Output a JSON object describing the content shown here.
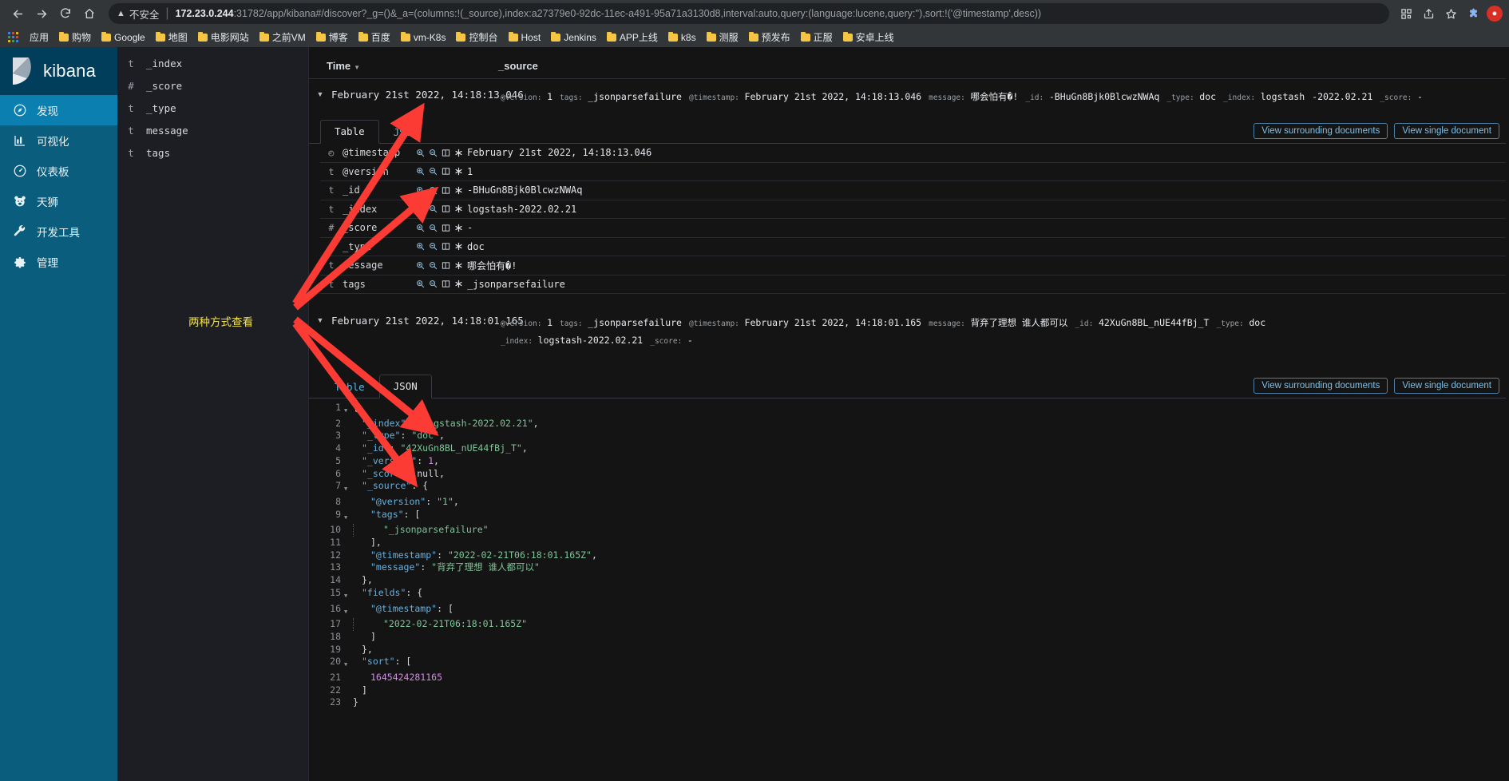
{
  "browser": {
    "nav": {
      "back_icon": "arrow-left-icon",
      "forward_icon": "arrow-right-icon",
      "reload_icon": "reload-icon",
      "home_icon": "home-icon"
    },
    "omnibox": {
      "security_icon": "warning-triangle-icon",
      "security_label": "不安全",
      "url_host": "172.23.0.244",
      "url_rest": ":31782/app/kibana#/discover?_g=()&_a=(columns:!(_source),index:a27379e0-92dc-11ec-a491-95a71a3130d8,interval:auto,query:(language:lucene,query:''),sort:!('@timestamp',desc))",
      "right_icons": [
        "qr-code-icon",
        "share-icon",
        "star-icon",
        "extensions-icon",
        "profile-avatar"
      ]
    },
    "bookmarks": {
      "apps_icon": "apps-grid-icon",
      "items": [
        {
          "label": "应用",
          "icon": "apps-grid-icon"
        },
        {
          "label": "购物",
          "icon": "folder-icon"
        },
        {
          "label": "Google",
          "icon": "folder-icon"
        },
        {
          "label": "地图",
          "icon": "folder-icon"
        },
        {
          "label": "电影网站",
          "icon": "folder-icon"
        },
        {
          "label": "之前VM",
          "icon": "folder-icon"
        },
        {
          "label": "博客",
          "icon": "folder-icon"
        },
        {
          "label": "百度",
          "icon": "folder-icon"
        },
        {
          "label": "vm-K8s",
          "icon": "folder-icon"
        },
        {
          "label": "控制台",
          "icon": "folder-icon"
        },
        {
          "label": "Host",
          "icon": "folder-icon"
        },
        {
          "label": "Jenkins",
          "icon": "folder-icon"
        },
        {
          "label": "APP上线",
          "icon": "folder-icon"
        },
        {
          "label": "k8s",
          "icon": "folder-icon"
        },
        {
          "label": "测服",
          "icon": "folder-icon"
        },
        {
          "label": "预发布",
          "icon": "folder-icon"
        },
        {
          "label": "正服",
          "icon": "folder-icon"
        },
        {
          "label": "安卓上线",
          "icon": "folder-icon"
        }
      ]
    }
  },
  "kibana": {
    "brand": "kibana",
    "nav": [
      {
        "label": "发现",
        "icon": "compass-icon",
        "active": true
      },
      {
        "label": "可视化",
        "icon": "bar-chart-icon",
        "active": false
      },
      {
        "label": "仪表板",
        "icon": "dashboard-icon",
        "active": false
      },
      {
        "label": "天狮",
        "icon": "bear-icon",
        "active": false
      },
      {
        "label": "开发工具",
        "icon": "wrench-icon",
        "active": false
      },
      {
        "label": "管理",
        "icon": "gear-icon",
        "active": false
      }
    ],
    "fields": [
      {
        "type": "t",
        "name": "_index"
      },
      {
        "type": "#",
        "name": "_score"
      },
      {
        "type": "t",
        "name": "_type"
      },
      {
        "type": "t",
        "name": "message"
      },
      {
        "type": "t",
        "name": "tags"
      }
    ],
    "table_header": {
      "time": "Time",
      "source": "_source",
      "sort_icon": "caret-down-icon"
    },
    "doc1": {
      "time": "February 21st 2022, 14:18:13.046",
      "source_pairs": [
        {
          "key": "@version:",
          "value": "1"
        },
        {
          "key": "tags:",
          "value": "_jsonparsefailure"
        },
        {
          "key": "@timestamp:",
          "value": "February 21st 2022, 14:18:13.046"
        },
        {
          "key": "message:",
          "value": "哪会怕有�!"
        },
        {
          "key": "_id:",
          "value": "-BHuGn8Bjk0BlcwzNWAq"
        },
        {
          "key": "_type:",
          "value": "doc"
        },
        {
          "key": "_index:",
          "value": "logstash"
        },
        {
          "key": "",
          "value": "-2022.02.21"
        },
        {
          "key": "_score:",
          "value": "-"
        }
      ],
      "tabs": [
        {
          "label": "Table",
          "active": true
        },
        {
          "label": "JSON",
          "active": false
        }
      ],
      "actions": [
        {
          "label": "View surrounding documents"
        },
        {
          "label": "View single document"
        }
      ],
      "detail_rows": [
        {
          "type": "◴",
          "name": "@timestamp",
          "value": "February 21st 2022, 14:18:13.046"
        },
        {
          "type": "t",
          "name": "@version",
          "value": "1"
        },
        {
          "type": "t",
          "name": "_id",
          "value": "-BHuGn8Bjk0BlcwzNWAq"
        },
        {
          "type": "t",
          "name": "_index",
          "value": "logstash-2022.02.21"
        },
        {
          "type": "#",
          "name": "_score",
          "value": "-"
        },
        {
          "type": "t",
          "name": "_type",
          "value": "doc"
        },
        {
          "type": "t",
          "name": "message",
          "value": "哪会怕有�!"
        },
        {
          "type": "t",
          "name": "tags",
          "value": "_jsonparsefailure"
        }
      ],
      "row_icons": [
        "zoom-in-icon",
        "zoom-out-icon",
        "toggle-column-icon",
        "filter-exists-icon"
      ]
    },
    "doc2": {
      "time": "February 21st 2022, 14:18:01.165",
      "source_pairs": [
        {
          "key": "@version:",
          "value": "1"
        },
        {
          "key": "tags:",
          "value": "_jsonparsefailure"
        },
        {
          "key": "@timestamp:",
          "value": "February 21st 2022, 14:18:01.165"
        },
        {
          "key": "message:",
          "value": "背弃了理想 谁人都可以"
        },
        {
          "key": "_id:",
          "value": "42XuGn8BL_nUE44fBj_T"
        },
        {
          "key": "_type:",
          "value": "doc"
        }
      ],
      "source_pairs_line2": [
        {
          "key": "_index:",
          "value": "logstash-2022.02.21"
        },
        {
          "key": "_score:",
          "value": "-"
        }
      ],
      "tabs": [
        {
          "label": "Table",
          "active": false
        },
        {
          "label": "JSON",
          "active": true
        }
      ],
      "actions": [
        {
          "label": "View surrounding documents"
        },
        {
          "label": "View single document"
        }
      ],
      "json_lines": [
        {
          "n": 1,
          "fold": true,
          "indent": 0,
          "tokens": [
            {
              "t": "p",
              "v": "{"
            }
          ]
        },
        {
          "n": 2,
          "fold": false,
          "indent": 1,
          "tokens": [
            {
              "t": "k",
              "v": "\"_index\""
            },
            {
              "t": "p",
              "v": ": "
            },
            {
              "t": "s",
              "v": "\"logstash-2022.02.21\""
            },
            {
              "t": "p",
              "v": ","
            }
          ]
        },
        {
          "n": 3,
          "fold": false,
          "indent": 1,
          "tokens": [
            {
              "t": "k",
              "v": "\"_type\""
            },
            {
              "t": "p",
              "v": ": "
            },
            {
              "t": "s",
              "v": "\"doc\""
            },
            {
              "t": "p",
              "v": ","
            }
          ]
        },
        {
          "n": 4,
          "fold": false,
          "indent": 1,
          "tokens": [
            {
              "t": "k",
              "v": "\"_id\""
            },
            {
              "t": "p",
              "v": ": "
            },
            {
              "t": "s",
              "v": "\"42XuGn8BL_nUE44fBj_T\""
            },
            {
              "t": "p",
              "v": ","
            }
          ]
        },
        {
          "n": 5,
          "fold": false,
          "indent": 1,
          "tokens": [
            {
              "t": "k",
              "v": "\"_version\""
            },
            {
              "t": "p",
              "v": ": "
            },
            {
              "t": "n",
              "v": "1"
            },
            {
              "t": "p",
              "v": ","
            }
          ]
        },
        {
          "n": 6,
          "fold": false,
          "indent": 1,
          "tokens": [
            {
              "t": "k",
              "v": "\"_score\""
            },
            {
              "t": "p",
              "v": ": "
            },
            {
              "t": "p",
              "v": "null"
            },
            {
              "t": "p",
              "v": ","
            }
          ]
        },
        {
          "n": 7,
          "fold": true,
          "indent": 1,
          "tokens": [
            {
              "t": "k",
              "v": "\"_source\""
            },
            {
              "t": "p",
              "v": ": {"
            }
          ]
        },
        {
          "n": 8,
          "fold": false,
          "indent": 2,
          "tokens": [
            {
              "t": "k",
              "v": "\"@version\""
            },
            {
              "t": "p",
              "v": ": "
            },
            {
              "t": "s",
              "v": "\"1\""
            },
            {
              "t": "p",
              "v": ","
            }
          ]
        },
        {
          "n": 9,
          "fold": true,
          "indent": 2,
          "tokens": [
            {
              "t": "k",
              "v": "\"tags\""
            },
            {
              "t": "p",
              "v": ": ["
            }
          ]
        },
        {
          "n": 10,
          "fold": false,
          "indent": 3,
          "guide": true,
          "tokens": [
            {
              "t": "s",
              "v": "\"_jsonparsefailure\""
            }
          ]
        },
        {
          "n": 11,
          "fold": false,
          "indent": 2,
          "tokens": [
            {
              "t": "p",
              "v": "],"
            }
          ]
        },
        {
          "n": 12,
          "fold": false,
          "indent": 2,
          "tokens": [
            {
              "t": "k",
              "v": "\"@timestamp\""
            },
            {
              "t": "p",
              "v": ": "
            },
            {
              "t": "s",
              "v": "\"2022-02-21T06:18:01.165Z\""
            },
            {
              "t": "p",
              "v": ","
            }
          ]
        },
        {
          "n": 13,
          "fold": false,
          "indent": 2,
          "tokens": [
            {
              "t": "k",
              "v": "\"message\""
            },
            {
              "t": "p",
              "v": ": "
            },
            {
              "t": "s",
              "v": "\"背弃了理想 谁人都可以\""
            }
          ]
        },
        {
          "n": 14,
          "fold": false,
          "indent": 1,
          "tokens": [
            {
              "t": "p",
              "v": "},"
            }
          ]
        },
        {
          "n": 15,
          "fold": true,
          "indent": 1,
          "tokens": [
            {
              "t": "k",
              "v": "\"fields\""
            },
            {
              "t": "p",
              "v": ": {"
            }
          ]
        },
        {
          "n": 16,
          "fold": true,
          "indent": 2,
          "tokens": [
            {
              "t": "k",
              "v": "\"@timestamp\""
            },
            {
              "t": "p",
              "v": ": ["
            }
          ]
        },
        {
          "n": 17,
          "fold": false,
          "indent": 3,
          "guide": true,
          "tokens": [
            {
              "t": "s",
              "v": "\"2022-02-21T06:18:01.165Z\""
            }
          ]
        },
        {
          "n": 18,
          "fold": false,
          "indent": 2,
          "tokens": [
            {
              "t": "p",
              "v": "]"
            }
          ]
        },
        {
          "n": 19,
          "fold": false,
          "indent": 1,
          "tokens": [
            {
              "t": "p",
              "v": "},"
            }
          ]
        },
        {
          "n": 20,
          "fold": true,
          "indent": 1,
          "tokens": [
            {
              "t": "k",
              "v": "\"sort\""
            },
            {
              "t": "p",
              "v": ": ["
            }
          ]
        },
        {
          "n": 21,
          "fold": false,
          "indent": 2,
          "tokens": [
            {
              "t": "n",
              "v": "1645424281165"
            }
          ]
        },
        {
          "n": 22,
          "fold": false,
          "indent": 1,
          "tokens": [
            {
              "t": "p",
              "v": "]"
            }
          ]
        },
        {
          "n": 23,
          "fold": false,
          "indent": 0,
          "tokens": [
            {
              "t": "p",
              "v": "}"
            }
          ]
        }
      ]
    }
  },
  "annotations": {
    "label": "两种方式查看",
    "arrow_color": "#fc3b34",
    "label_color": "#f2e34c"
  }
}
